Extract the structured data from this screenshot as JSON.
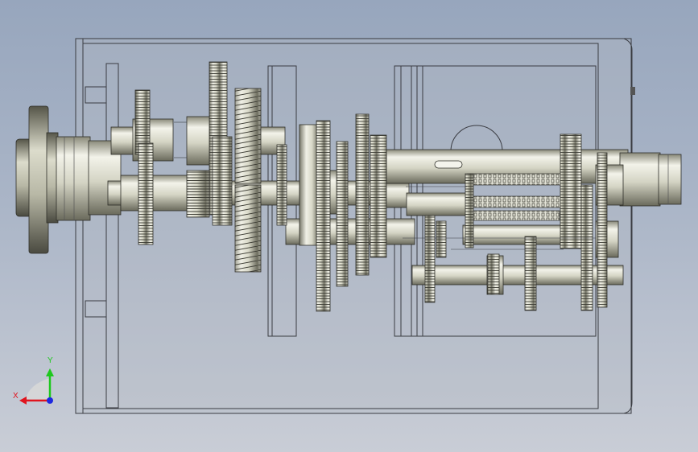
{
  "viewport": {
    "background_top": "#97a6bd",
    "background_bottom": "#c9cdd6"
  },
  "model": {
    "housing_stroke": "#3a3c42",
    "metal_light": "#efefe6",
    "metal_mid": "#c8c8b8",
    "metal_dark": "#6e6e60"
  },
  "triad": {
    "x_label": "X",
    "y_label": "Y",
    "x_color": "#e0141e",
    "y_color": "#1ec81e",
    "z_color": "#1e28e0"
  }
}
